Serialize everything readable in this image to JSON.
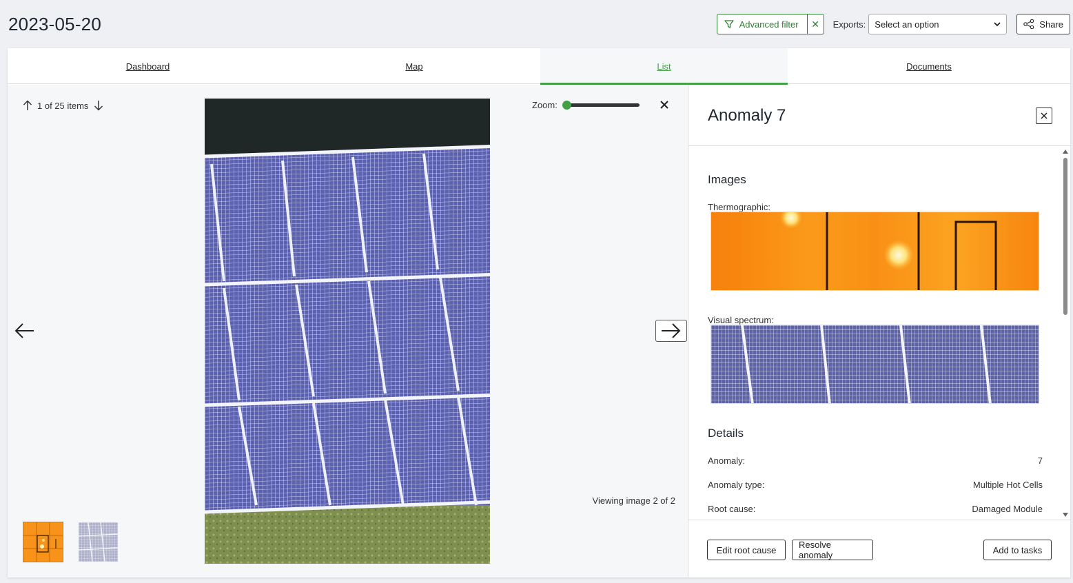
{
  "page": {
    "title": "2023-05-20"
  },
  "toolbar": {
    "advanced_filter_label": "Advanced filter",
    "clear_filter_symbol": "✕",
    "exports_label": "Exports:",
    "exports_selected": "Select an option",
    "share_label": "Share",
    "accent_color": "#2e7d32"
  },
  "tabs": [
    {
      "label": "Dashboard",
      "active": false
    },
    {
      "label": "Map",
      "active": false
    },
    {
      "label": "List",
      "active": true
    },
    {
      "label": "Documents",
      "active": false
    }
  ],
  "viewer": {
    "item_counter": "1 of 25 items",
    "zoom_label": "Zoom:",
    "zoom_level": 0,
    "viewing_text": "Viewing image 2 of 2",
    "thumbnails": [
      {
        "kind": "thermographic"
      },
      {
        "kind": "visual"
      }
    ]
  },
  "panel": {
    "title": "Anomaly 7",
    "images_heading": "Images",
    "thermographic_label": "Thermographic:",
    "visual_label": "Visual spectrum:",
    "details_heading": "Details",
    "details": [
      {
        "label": "Anomaly:",
        "value": "7"
      },
      {
        "label": "Anomaly type:",
        "value": "Multiple Hot Cells"
      },
      {
        "label": "Root cause:",
        "value": "Damaged Module"
      }
    ],
    "buttons": {
      "edit_root_cause": "Edit root cause",
      "resolve_anomaly": "Resolve anomaly",
      "add_to_tasks": "Add to tasks"
    }
  },
  "icons": {
    "filter": "filter-icon",
    "share": "share-icon",
    "up": "arrow-up-icon",
    "down": "arrow-down-icon",
    "left": "arrow-left-icon",
    "right": "arrow-right-icon",
    "close": "close-icon"
  }
}
